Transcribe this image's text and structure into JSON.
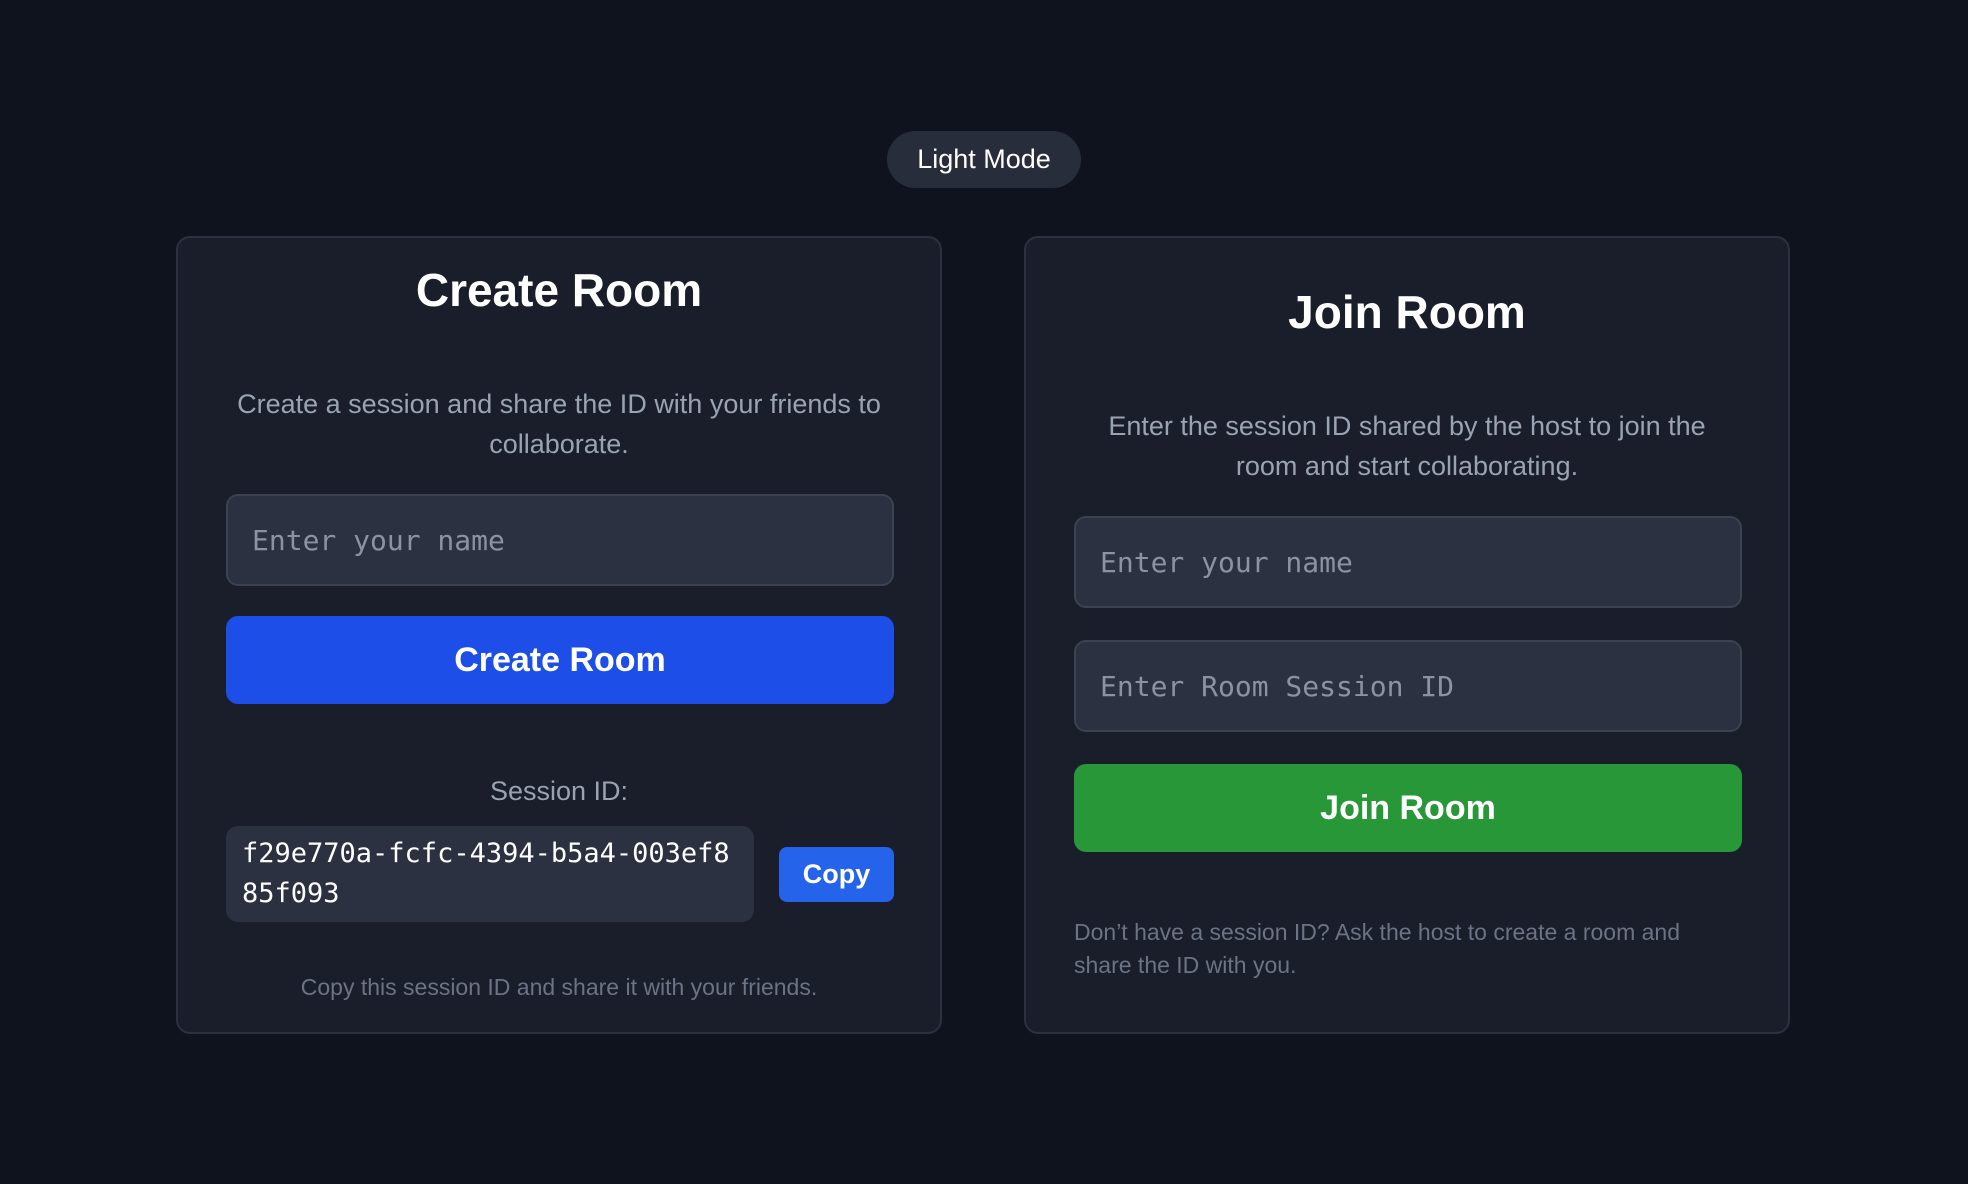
{
  "theme_toggle": {
    "label": "Light Mode"
  },
  "create_room": {
    "title": "Create Room",
    "description": "Create a session and share the ID with your friends to collaborate.",
    "name_input": {
      "placeholder": "Enter your name",
      "value": ""
    },
    "submit_label": "Create Room",
    "session_label": "Session ID:",
    "session_id": "f29e770a-fcfc-4394-b5a4-003ef885f093",
    "copy_label": "Copy",
    "hint": "Copy this session ID and share it with your friends."
  },
  "join_room": {
    "title": "Join Room",
    "description": "Enter the session ID shared by the host to join the room and start collaborating.",
    "name_input": {
      "placeholder": "Enter your name",
      "value": ""
    },
    "session_input": {
      "placeholder": "Enter Room Session ID",
      "value": ""
    },
    "submit_label": "Join Room",
    "hint": "Don’t have a session ID? Ask the host to create a room and share the ID with you."
  },
  "colors": {
    "background": "#0f131d",
    "card": "#191e2a",
    "primary_blue": "#1d4ee8",
    "copy_blue": "#2563eb",
    "join_green": "#289737"
  }
}
